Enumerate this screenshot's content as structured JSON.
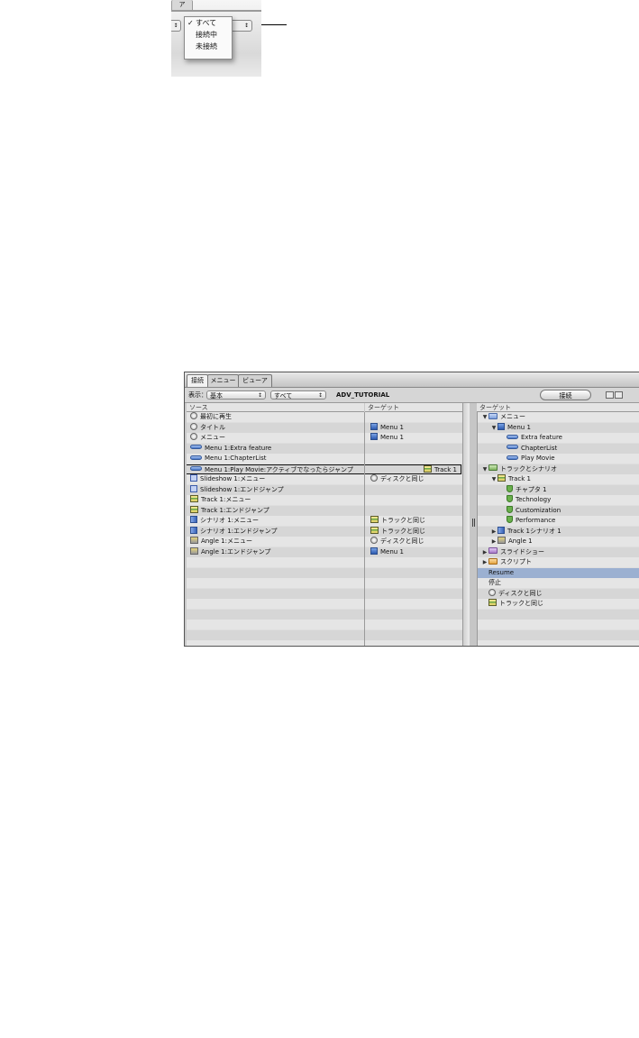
{
  "popup_crop": {
    "tab_fragment": "ア",
    "left_popup_arrow": "↕",
    "right_popup_arrow": "↕",
    "menu_items": [
      {
        "label": "すべて",
        "checked": true
      },
      {
        "label": "接続中",
        "checked": false
      },
      {
        "label": "未接続",
        "checked": false
      }
    ],
    "check_mark": "✓"
  },
  "window": {
    "tabs": [
      "接続",
      "メニュー",
      "ビューア"
    ],
    "active_tab": 0,
    "toolbar": {
      "view_label": "表示：",
      "view_value": "基本",
      "filter_value": "すべて",
      "project_name": "ADV_TUTORIAL",
      "connect_button": "接続",
      "arrow": "↕"
    },
    "source_header": "ソース",
    "target_header": "ターゲット",
    "tree_header": "ターゲット",
    "rows": [
      {
        "icon": "circle",
        "source": "最初に再生",
        "target_icon": "",
        "target": ""
      },
      {
        "icon": "circle",
        "source": "タイトル",
        "target_icon": "menu",
        "target": "Menu 1"
      },
      {
        "icon": "circle",
        "source": "メニュー",
        "target_icon": "menu",
        "target": "Menu 1"
      },
      {
        "icon": "pill",
        "source": "Menu 1:Extra feature",
        "target_icon": "",
        "target": ""
      },
      {
        "icon": "pill",
        "source": "Menu 1:ChapterList",
        "target_icon": "",
        "target": ""
      },
      {
        "icon": "pill",
        "source": "Menu 1:Play Movie:アクティブでなったらジャンプ",
        "target_icon": "track",
        "target": "Track 1",
        "selected": true
      },
      {
        "icon": "show",
        "source": "Slideshow 1:メニュー",
        "target_icon": "circle",
        "target": "ディスクと同じ"
      },
      {
        "icon": "show",
        "source": "Slideshow 1:エンドジャンプ",
        "target_icon": "",
        "target": ""
      },
      {
        "icon": "track",
        "source": "Track 1:メニュー",
        "target_icon": "",
        "target": ""
      },
      {
        "icon": "track",
        "source": "Track 1:エンドジャンプ",
        "target_icon": "",
        "target": ""
      },
      {
        "icon": "scen",
        "source": "シナリオ 1:メニュー",
        "target_icon": "track",
        "target": "トラックと同じ"
      },
      {
        "icon": "scen",
        "source": "シナリオ 1:エンドジャンプ",
        "target_icon": "track",
        "target": "トラックと同じ"
      },
      {
        "icon": "angle",
        "source": "Angle 1:メニュー",
        "target_icon": "circle",
        "target": "ディスクと同じ"
      },
      {
        "icon": "angle",
        "source": "Angle 1:エンドジャンプ",
        "target_icon": "menu",
        "target": "Menu 1"
      }
    ],
    "tree": [
      {
        "depth": 0,
        "toggle": "▼",
        "icon": "folder",
        "label": "メニュー"
      },
      {
        "depth": 1,
        "toggle": "▼",
        "icon": "menu",
        "label": "Menu 1"
      },
      {
        "depth": 2,
        "toggle": "",
        "icon": "pill",
        "label": "Extra feature"
      },
      {
        "depth": 2,
        "toggle": "",
        "icon": "pill",
        "label": "ChapterList"
      },
      {
        "depth": 2,
        "toggle": "",
        "icon": "pill",
        "label": "Play Movie"
      },
      {
        "depth": 0,
        "toggle": "▼",
        "icon": "folder-green",
        "label": "トラックとシナリオ"
      },
      {
        "depth": 1,
        "toggle": "▼",
        "icon": "track",
        "label": "Track 1"
      },
      {
        "depth": 2,
        "toggle": "",
        "icon": "shield",
        "label": "チャプタ 1"
      },
      {
        "depth": 2,
        "toggle": "",
        "icon": "shield",
        "label": "Technology"
      },
      {
        "depth": 2,
        "toggle": "",
        "icon": "shield",
        "label": "Customization"
      },
      {
        "depth": 2,
        "toggle": "",
        "icon": "shield",
        "label": "Performance"
      },
      {
        "depth": 1,
        "toggle": "▶",
        "icon": "scen",
        "label": "Track 1シナリオ 1"
      },
      {
        "depth": 1,
        "toggle": "▶",
        "icon": "angle",
        "label": "Angle 1"
      },
      {
        "depth": 0,
        "toggle": "▶",
        "icon": "folder-purple",
        "label": "スライドショー"
      },
      {
        "depth": 0,
        "toggle": "▶",
        "icon": "folder-orange",
        "label": "スクリプト"
      },
      {
        "depth": 0,
        "toggle": "",
        "icon": "",
        "label": "Resume",
        "highlight": true
      },
      {
        "depth": 0,
        "toggle": "",
        "icon": "",
        "label": "停止"
      },
      {
        "depth": 0,
        "toggle": "",
        "icon": "circle",
        "label": "ディスクと同じ"
      },
      {
        "depth": 0,
        "toggle": "",
        "icon": "track",
        "label": "トラックと同じ"
      }
    ]
  }
}
